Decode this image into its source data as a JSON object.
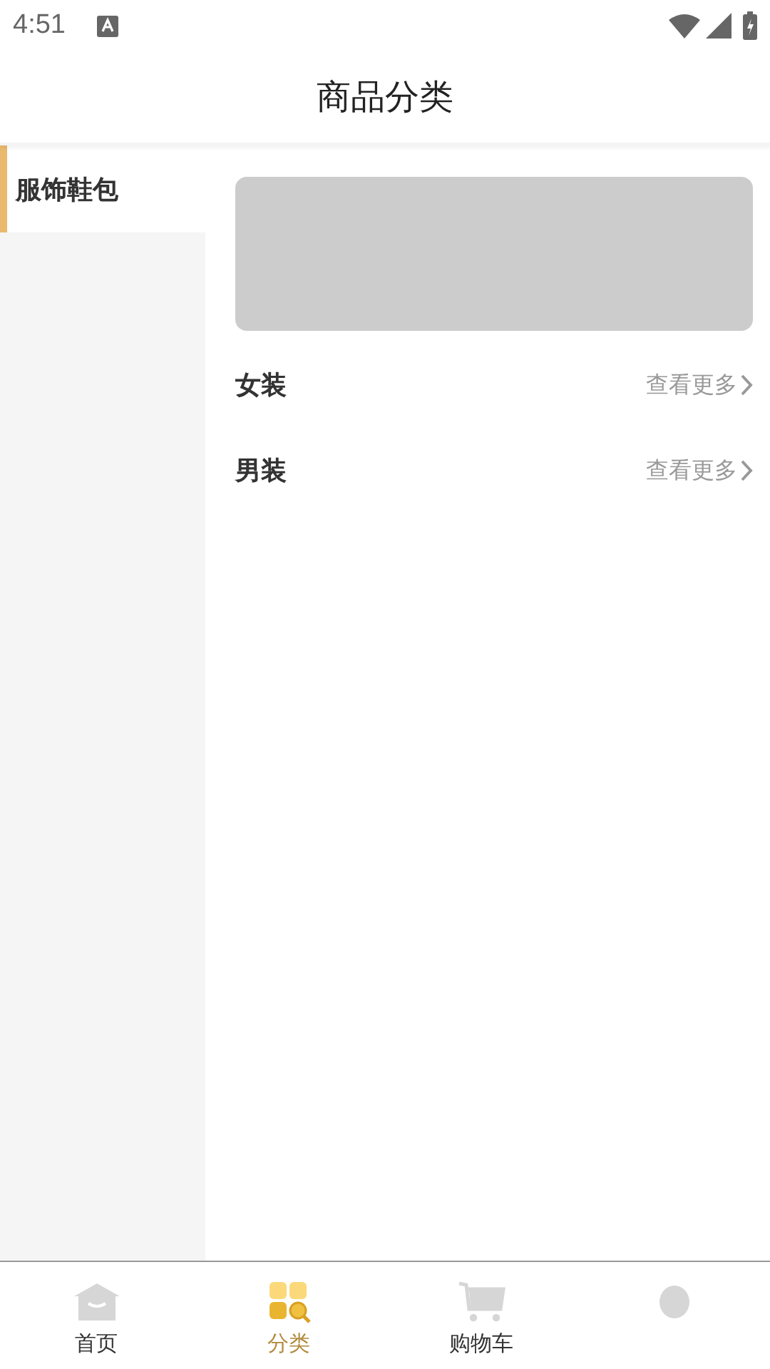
{
  "status_bar": {
    "time": "4:51"
  },
  "header": {
    "title": "商品分类"
  },
  "sidebar": {
    "items": [
      {
        "label": "服饰鞋包",
        "selected": true
      }
    ]
  },
  "content": {
    "sections": [
      {
        "title": "女装",
        "more": "查看更多"
      },
      {
        "title": "男装",
        "more": "查看更多"
      }
    ]
  },
  "tab_bar": {
    "tabs": [
      {
        "kind": "home",
        "label": "首页",
        "selected": false
      },
      {
        "kind": "category",
        "label": "分类",
        "selected": true
      },
      {
        "kind": "cart",
        "label": "购物车",
        "selected": false
      },
      {
        "kind": "profile",
        "selected": false
      }
    ]
  }
}
